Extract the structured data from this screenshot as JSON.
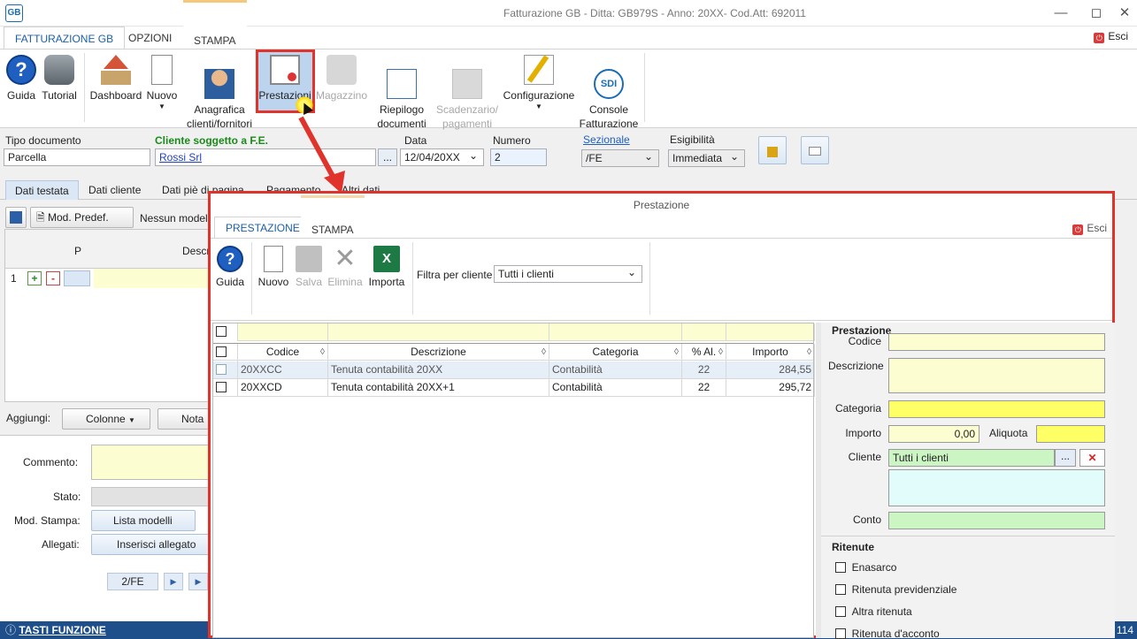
{
  "window": {
    "logo": "GB",
    "title": "Fatturazione GB - Ditta: GB979S - Anno: 20XX- Cod.Att: 692011",
    "controls": [
      "minimize-icon",
      "maximize-icon",
      "close-icon"
    ]
  },
  "ribbon_tabs": [
    "FATTURAZIONE GB",
    "OPZIONI",
    "STAMPA"
  ],
  "esci_label": "Esci",
  "ribbon_buttons": [
    {
      "label": "Guida",
      "icon": "help-icon"
    },
    {
      "label": "Tutorial",
      "icon": "tutorial-icon"
    },
    {
      "label": "Dashboard",
      "icon": "home-icon"
    },
    {
      "label": "Nuovo",
      "icon": "new-document-icon"
    },
    {
      "label": "Anagrafica\nclienti/fornitori",
      "icon": "user-icon"
    },
    {
      "label": "Prestazioni",
      "icon": "services-icon"
    },
    {
      "label": "Magazzino",
      "icon": "truck-icon"
    },
    {
      "label": "Riepilogo\ndocumenti",
      "icon": "list-icon"
    },
    {
      "label": "Scadenzario/\npagamenti",
      "icon": "calculator-icon"
    },
    {
      "label": "Configurazione",
      "icon": "pencil-icon"
    },
    {
      "label": "Console\nFatturazione",
      "icon": "sdi-icon"
    }
  ],
  "header": {
    "tipo_label": "Tipo documento",
    "tipo_value": "Parcella",
    "cliente_label": "Cliente soggetto a F.E.",
    "cliente_value": "Rossi Srl",
    "ellipsis": "...",
    "data_label": "Data",
    "data_value": "12/04/20XX",
    "numero_label": "Numero",
    "numero_value": "2",
    "sezionale_label": "Sezionale",
    "sezionale_value": "/FE",
    "esigibilita_label": "Esigibilità",
    "esigibilita_value": "Immediata"
  },
  "sub_tabs": [
    "Dati testata",
    "Dati cliente",
    "Dati piè di pagina",
    "Pagamento",
    "Altri dati"
  ],
  "left_panel": {
    "mod_predef": "Mod. Predef.",
    "nessun_modello": "Nessun model",
    "col_p": "P",
    "col_desc": "Descr",
    "row_num": "1",
    "aggiungi": "Aggiungi:",
    "colonne": "Colonne",
    "nota": "Nota",
    "commento": "Commento:",
    "stato": "Stato:",
    "mod_stampa": "Mod. Stampa:",
    "lista_modelli": "Lista modelli",
    "allegati": "Allegati:",
    "inserisci_allegato": "Inserisci allegato",
    "pager": "2/FE"
  },
  "status_bar": {
    "tasti": "TASTI FUNZIONE",
    "right_num": "114"
  },
  "modal": {
    "title": "Prestazione",
    "tabs": [
      "PRESTAZIONE",
      "STAMPA"
    ],
    "esci": "Esci",
    "buttons": [
      {
        "label": "Guida",
        "icon": "help-icon"
      },
      {
        "label": "Nuovo",
        "icon": "new-document-icon"
      },
      {
        "label": "Salva",
        "icon": "save-icon"
      },
      {
        "label": "Elimina",
        "icon": "delete-icon"
      },
      {
        "label": "Importa",
        "icon": "excel-icon"
      }
    ],
    "filter_label": "Filtra per cliente",
    "filter_value": "Tutti i clienti",
    "grid": {
      "columns": [
        "Codice",
        "Descrizione",
        "Categoria",
        "% Al.",
        "Importo"
      ],
      "rows": [
        {
          "codice": "20XXCC",
          "descrizione": "Tenuta contabilità 20XX",
          "categoria": "Contabilità",
          "aliquota": "22",
          "importo": "284,55"
        },
        {
          "codice": "20XXCD",
          "descrizione": "Tenuta contabilità 20XX+1",
          "categoria": "Contabilità",
          "aliquota": "22",
          "importo": "295,72"
        }
      ]
    },
    "form": {
      "section_title": "Prestazione",
      "codice_label": "Codice",
      "descrizione_label": "Descrizione",
      "categoria_label": "Categoria",
      "importo_label": "Importo",
      "importo_value": "0,00",
      "aliquota_label": "Aliquota",
      "cliente_label": "Cliente",
      "cliente_value": "Tutti i clienti",
      "conto_label": "Conto",
      "ritenute_title": "Ritenute",
      "ritenute": [
        "Enasarco",
        "Ritenuta previdenziale",
        "Altra ritenuta",
        "Ritenuta d'acconto"
      ]
    }
  },
  "colors": {
    "accent": "#1b5fa8",
    "highlight": "#e0332b",
    "statusbar": "#1e4f8a"
  }
}
